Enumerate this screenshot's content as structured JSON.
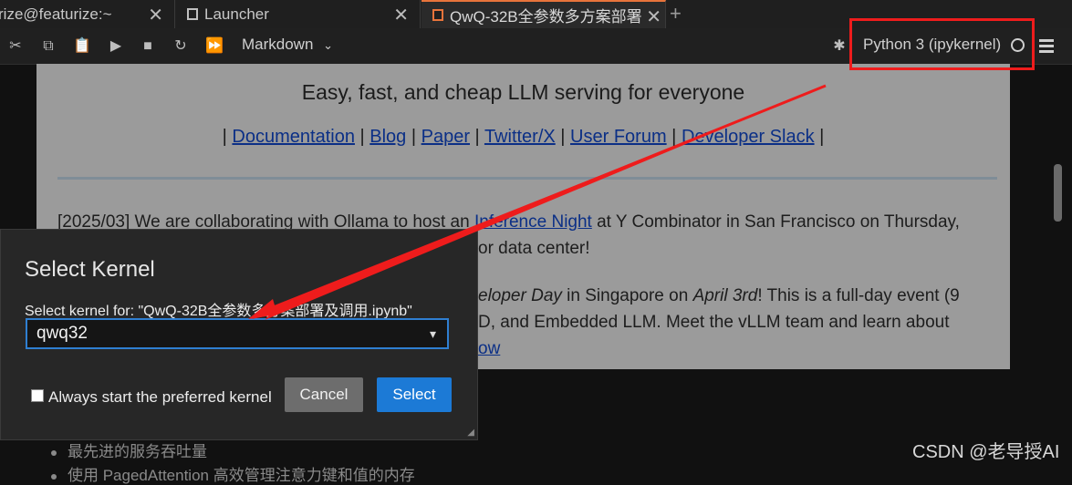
{
  "tabs": [
    {
      "label": "rize@featurize:~",
      "close": "✕"
    },
    {
      "label": "Launcher",
      "close": "✕"
    },
    {
      "label": "QwQ-32B全参数多方案部署",
      "close": "✕"
    }
  ],
  "new_tab": "+",
  "toolbar": {
    "cell_type": "Markdown",
    "kernel_name": "Python 3 (ipykernel)"
  },
  "page": {
    "title": "Easy, fast, and cheap LLM serving for everyone",
    "links": [
      "Documentation",
      "Blog",
      "Paper",
      "Twitter/X",
      "User Forum",
      "Developer Slack"
    ],
    "news1_a": "[2025/03] We are collaborating with Ollama to host an ",
    "news1_link": "Inference Night",
    "news1_b": " at Y Combinator in San Francisco on Thursday,",
    "news1_c": "or data center!",
    "news2_a": "eloper Day",
    "news2_b": " in Singapore on ",
    "news2_c": "April 3rd",
    "news2_d": "! This is a full-day event (9",
    "news3": "D, and Embedded LLM. Meet the vLLM team and learn about",
    "news4_link": "ow"
  },
  "bullets": [
    "最先进的服务吞吐量",
    "使用 PagedAttention 高效管理注意力键和值的内存"
  ],
  "dialog": {
    "title": "Select Kernel",
    "label": "Select kernel for: \"QwQ-32B全参数多方案部署及调用.ipynb\"",
    "selected_kernel": "qwq32",
    "checkbox_label": "Always start the preferred kernel",
    "cancel_label": "Cancel",
    "select_label": "Select"
  },
  "watermark": "CSDN @老导授AI",
  "colors": {
    "annotation": "#ee1c1c",
    "primary_button": "#1c7ad6",
    "link": "#0b2f86"
  }
}
